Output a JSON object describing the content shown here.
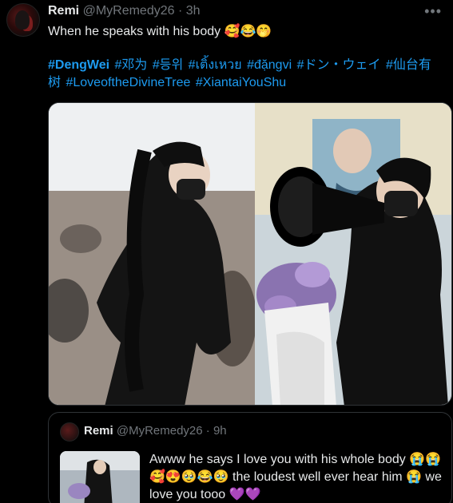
{
  "tweet": {
    "author_name": "Remi",
    "handle": "@MyRemedy26",
    "separator": "·",
    "time": "3h",
    "more_label": "•••",
    "text": "When he speaks with his body 🥰😂🤭",
    "hashtags": [
      "#DengWei",
      "#邓为",
      "#등위",
      "#เติ้งเหวย",
      "#đặngvi",
      "#ドン・ウェイ",
      "#仙台有树",
      "#LoveoftheDivineTree",
      "#XiantaiYouShu"
    ]
  },
  "quoted": {
    "author_name": "Remi",
    "handle": "@MyRemedy26",
    "separator": "·",
    "time": "9h",
    "text": "Awww he says I love you with his whole body 😭😭🥰😍🥹😂🥹 the loudest well ever hear him 😭 we love you tooo 💜💜"
  },
  "colors": {
    "background": "#000000",
    "link": "#1d9bf0",
    "muted": "#71767b",
    "text": "#e7e9ea"
  }
}
